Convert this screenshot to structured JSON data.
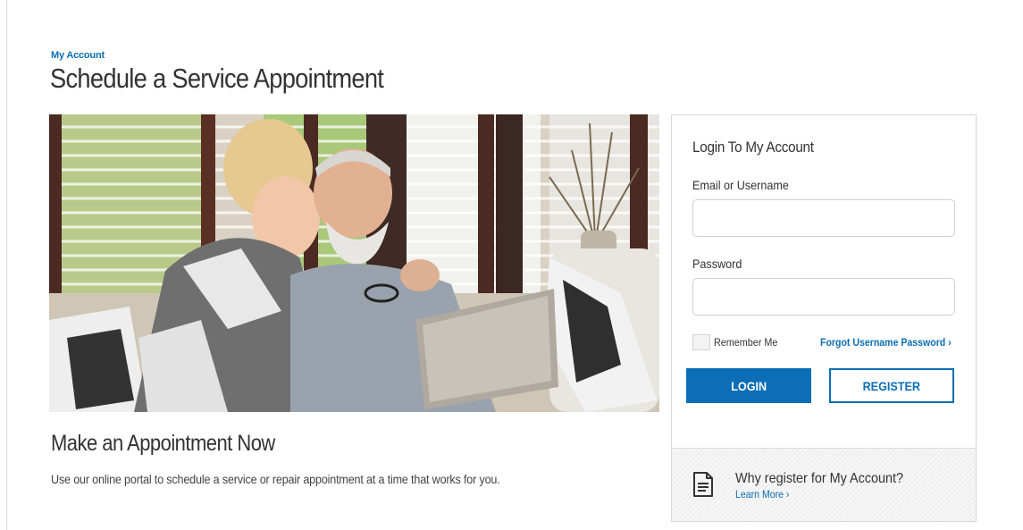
{
  "header": {
    "breadcrumb": "My Account",
    "title": "Schedule a Service Appointment"
  },
  "hero": {
    "image_icon": "photo-senior-couple-laptop"
  },
  "intro": {
    "heading": "Make an Appointment Now",
    "description": "Use our online portal to schedule a service or repair appointment at a time that works for you."
  },
  "login": {
    "title": "Login To My Account",
    "email_label": "Email or Username",
    "email_value": "",
    "password_label": "Password",
    "password_value": "",
    "remember_label": "Remember Me",
    "remember_checked": false,
    "forgot_link": "Forgot Username Password ›",
    "login_button": "LOGIN",
    "register_button": "REGISTER"
  },
  "why_register": {
    "icon": "document-icon",
    "title": "Why register for My Account?",
    "link": "Learn More ›"
  },
  "colors": {
    "accent": "#0b6eb6",
    "text": "#333333",
    "border": "#d6d6d6"
  }
}
